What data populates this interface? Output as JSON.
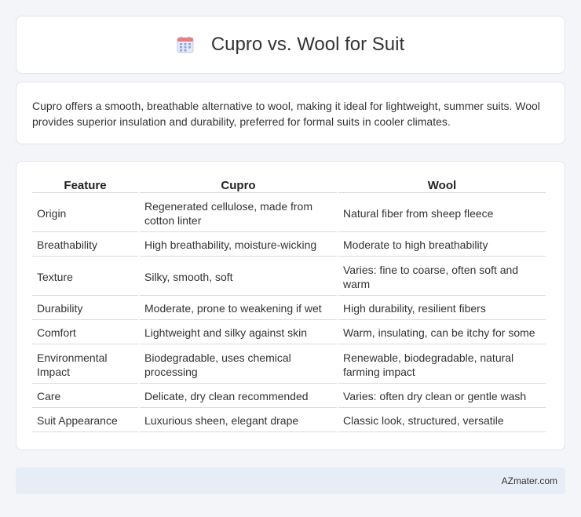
{
  "header": {
    "title": "Cupro vs. Wool for Suit",
    "icon": "calendar-icon"
  },
  "summary": {
    "text": "Cupro offers a smooth, breathable alternative to wool, making it ideal for lightweight, summer suits. Wool provides superior insulation and durability, preferred for formal suits in cooler climates."
  },
  "table": {
    "headers": [
      "Feature",
      "Cupro",
      "Wool"
    ],
    "rows": [
      [
        "Origin",
        "Regenerated cellulose, made from cotton linter",
        "Natural fiber from sheep fleece"
      ],
      [
        "Breathability",
        "High breathability, moisture-wicking",
        "Moderate to high breathability"
      ],
      [
        "Texture",
        "Silky, smooth, soft",
        "Varies: fine to coarse, often soft and warm"
      ],
      [
        "Durability",
        "Moderate, prone to weakening if wet",
        "High durability, resilient fibers"
      ],
      [
        "Comfort",
        "Lightweight and silky against skin",
        "Warm, insulating, can be itchy for some"
      ],
      [
        "Environmental Impact",
        "Biodegradable, uses chemical processing",
        "Renewable, biodegradable, natural farming impact"
      ],
      [
        "Care",
        "Delicate, dry clean recommended",
        "Varies: often dry clean or gentle wash"
      ],
      [
        "Suit Appearance",
        "Luxurious sheen, elegant drape",
        "Classic look, structured, versatile"
      ]
    ]
  },
  "footer": {
    "brand": "AZmater.com"
  },
  "colors": {
    "background": "#f3f5f9",
    "footer_bg": "#e7edf7",
    "icon_top": "#f07a7a",
    "icon_grid": "#8fa0e0"
  }
}
